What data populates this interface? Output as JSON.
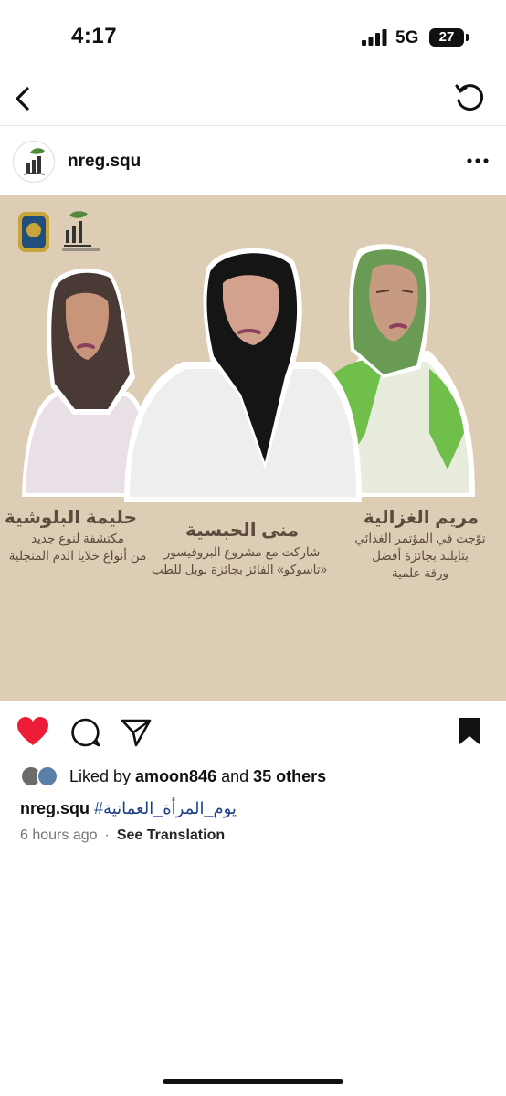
{
  "status_bar": {
    "time": "4:17",
    "network": "5G",
    "battery": "27"
  },
  "post": {
    "username": "nreg.squ",
    "image": {
      "people": [
        {
          "name": "حليمة البلوشية",
          "desc_lines": [
            "مكتشفة لنوع جديد",
            "من أنواع خلايا الدم المنجلية"
          ]
        },
        {
          "name": "منى الحبسية",
          "desc_lines": [
            "شاركت مع مشروع البروفيسور",
            "«تاسوكو» الفائز بجائزة نوبل للطب"
          ]
        },
        {
          "name": "مريم الغزالية",
          "desc_lines": [
            "توّجت في المؤتمر الغذائي",
            "بتايلند بجائزة أفضل",
            "ورقة علمية"
          ]
        }
      ]
    },
    "likes": {
      "prefix": "Liked by ",
      "user": "amoon846",
      "middle": " and ",
      "others": "35 others"
    },
    "caption": {
      "username": "nreg.squ",
      "hashtag": "#يوم_المرأة_العمانية"
    },
    "time_ago": "6 hours ago",
    "see_translation": "See Translation"
  },
  "colors": {
    "heart": "#ed1d3a",
    "image_bg": "#ddcdb4",
    "text_brown": "#5c4a3d",
    "hashtag": "#1c3f8a"
  },
  "icons": [
    "back-arrow-icon",
    "refresh-icon",
    "more-icon",
    "heart-icon",
    "comment-icon",
    "share-icon",
    "bookmark-icon"
  ]
}
